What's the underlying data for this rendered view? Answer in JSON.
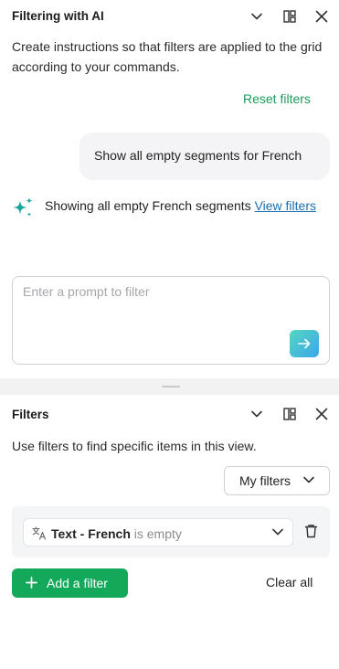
{
  "ai_panel": {
    "title": "Filtering with AI",
    "header_icons": [
      "chevron-down-icon",
      "split-view-icon",
      "close-icon"
    ],
    "description": "Create instructions so that filters are applied to the grid according to your commands.",
    "reset_label": "Reset filters",
    "user_message": "Show all empty segments for French",
    "ai_response_text": "Showing all empty French segments ",
    "ai_response_link": "View filters",
    "prompt_placeholder": "Enter a prompt to filter",
    "prompt_value": "",
    "send_icon": "arrow-right-icon"
  },
  "filters_panel": {
    "title": "Filters",
    "header_icons": [
      "chevron-down-icon",
      "split-view-icon",
      "close-icon"
    ],
    "description": "Use filters to find specific items in this view.",
    "my_filters_label": "My filters",
    "filters": [
      {
        "icon": "translate-icon",
        "field": "Text - French",
        "condition": " is empty"
      }
    ],
    "add_filter_label": "Add a filter",
    "clear_all_label": "Clear all"
  },
  "colors": {
    "accent_green": "#14a85a",
    "link_green": "#1e9a5a",
    "link_blue": "#1a6fb0",
    "sparkle_teal": "#1aa6a0",
    "send_gradient": [
      "#55d6c2",
      "#3aa7e8"
    ]
  }
}
